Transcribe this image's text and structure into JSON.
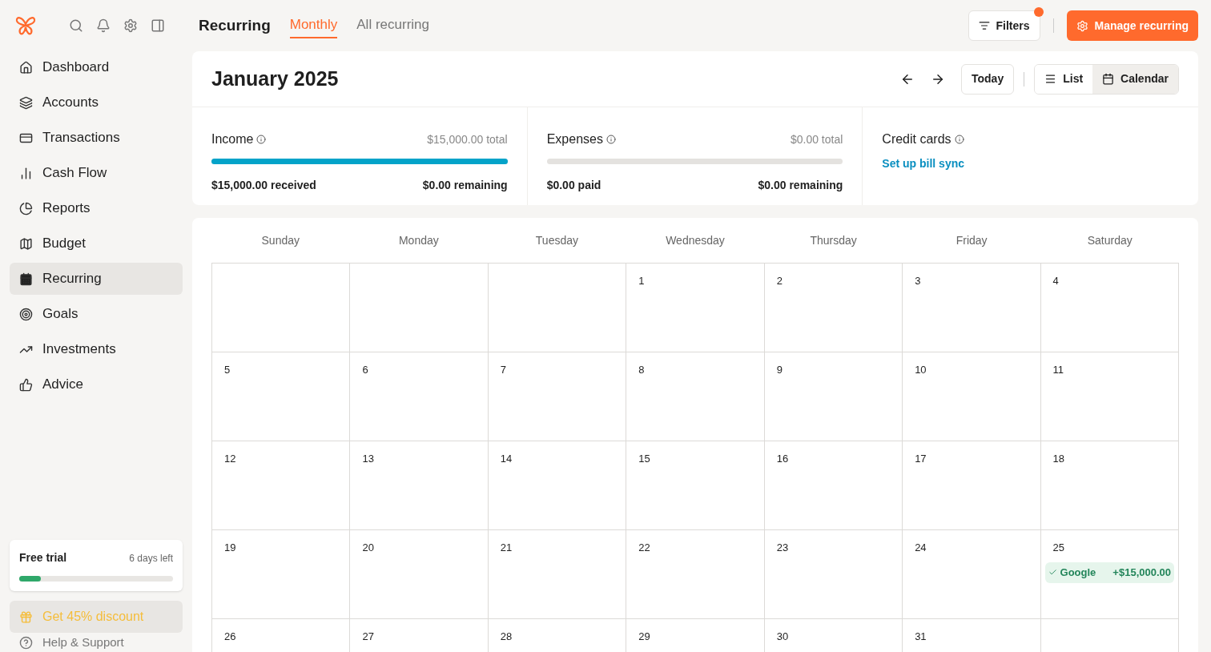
{
  "page_title": "Recurring",
  "tabs": [
    {
      "label": "Monthly",
      "selected": true
    },
    {
      "label": "All recurring",
      "selected": false
    }
  ],
  "filters": {
    "label": "Filters",
    "has_dot": true
  },
  "manage_button": "Manage recurring",
  "sidebar": {
    "items": [
      {
        "label": "Dashboard",
        "selected": false
      },
      {
        "label": "Accounts",
        "selected": false
      },
      {
        "label": "Transactions",
        "selected": false
      },
      {
        "label": "Cash Flow",
        "selected": false
      },
      {
        "label": "Reports",
        "selected": false
      },
      {
        "label": "Budget",
        "selected": false
      },
      {
        "label": "Recurring",
        "selected": true
      },
      {
        "label": "Goals",
        "selected": false
      },
      {
        "label": "Investments",
        "selected": false
      },
      {
        "label": "Advice",
        "selected": false
      }
    ],
    "trial": {
      "title": "Free trial",
      "days_left": "6 days left",
      "level": 0.14
    },
    "discount": "Get 45% discount",
    "help": "Help & Support"
  },
  "month": {
    "title": "January 2025",
    "today": "Today",
    "views": [
      {
        "label": "List",
        "selected": false
      },
      {
        "label": "Calendar",
        "selected": true
      }
    ]
  },
  "summary": [
    {
      "kind": "progress",
      "title": "Income",
      "total": "$15,000.00 total",
      "level": 1,
      "left": "$15,000.00 received",
      "right": "$0.00 remaining"
    },
    {
      "kind": "progress",
      "title": "Expenses",
      "total": "$0.00 total",
      "level": 0,
      "left": "$0.00 paid",
      "right": "$0.00 remaining"
    },
    {
      "kind": "link",
      "title": "Credit cards",
      "link": "Set up bill sync"
    }
  ],
  "calendar": {
    "weekdays": [
      "Sunday",
      "Monday",
      "Tuesday",
      "Wednesday",
      "Thursday",
      "Friday",
      "Saturday"
    ],
    "weeks": [
      [
        {
          "kind": "blank"
        },
        {
          "kind": "blank"
        },
        {
          "kind": "blank"
        },
        {
          "kind": "day",
          "day": "1"
        },
        {
          "kind": "day",
          "day": "2"
        },
        {
          "kind": "day",
          "day": "3"
        },
        {
          "kind": "day",
          "day": "4"
        }
      ],
      [
        {
          "kind": "day",
          "day": "5"
        },
        {
          "kind": "day",
          "day": "6"
        },
        {
          "kind": "day",
          "day": "7"
        },
        {
          "kind": "day",
          "day": "8"
        },
        {
          "kind": "day",
          "day": "9"
        },
        {
          "kind": "day",
          "day": "10"
        },
        {
          "kind": "day",
          "day": "11"
        }
      ],
      [
        {
          "kind": "day",
          "day": "12"
        },
        {
          "kind": "day",
          "day": "13"
        },
        {
          "kind": "day",
          "day": "14"
        },
        {
          "kind": "day",
          "day": "15"
        },
        {
          "kind": "day",
          "day": "16"
        },
        {
          "kind": "day",
          "day": "17"
        },
        {
          "kind": "day",
          "day": "18"
        }
      ],
      [
        {
          "kind": "day",
          "day": "19"
        },
        {
          "kind": "day",
          "day": "20"
        },
        {
          "kind": "day",
          "day": "21"
        },
        {
          "kind": "day",
          "day": "22"
        },
        {
          "kind": "day",
          "day": "23"
        },
        {
          "kind": "day",
          "day": "24"
        },
        {
          "kind": "day",
          "day": "25",
          "events": [
            {
              "name": "Google",
              "amount": "+$15,000.00",
              "paid": true
            }
          ]
        }
      ],
      [
        {
          "kind": "day",
          "day": "26"
        },
        {
          "kind": "day",
          "day": "27"
        },
        {
          "kind": "day",
          "day": "28"
        },
        {
          "kind": "day",
          "day": "29"
        },
        {
          "kind": "day",
          "day": "30"
        },
        {
          "kind": "day",
          "day": "31"
        },
        {
          "kind": "blank"
        }
      ]
    ]
  }
}
